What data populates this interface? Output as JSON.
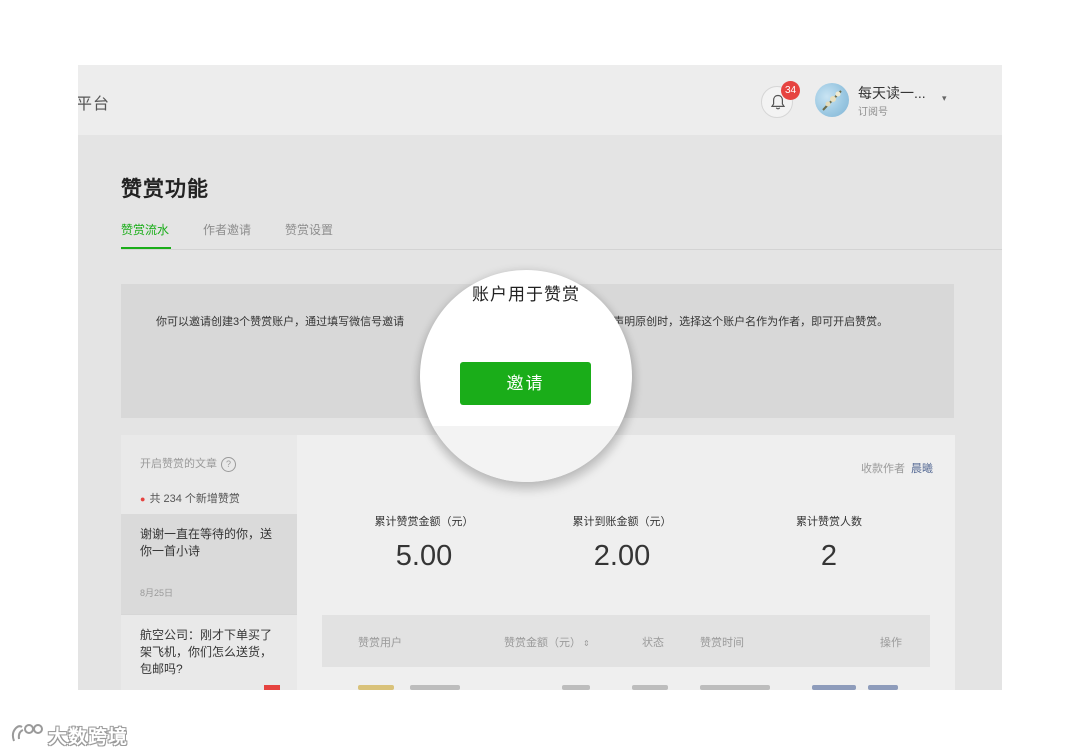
{
  "topbar": {
    "brand": "平台",
    "notification_count": "34",
    "account_name": "每天读一...",
    "account_type": "订阅号",
    "caret": "▾"
  },
  "page": {
    "title": "赞赏功能",
    "tabs": [
      {
        "label": "赞赏流水",
        "active": true
      },
      {
        "label": "作者邀请",
        "active": false
      },
      {
        "label": "赞赏设置",
        "active": false
      }
    ]
  },
  "notice": {
    "text": "你可以邀请创建3个赞赏账户，通过填写微信号邀请　　　　　　　　　　　　　　　你在文章声明原创时，选择这个账户名作为作者，即可开启赞赏。"
  },
  "magnifier": {
    "heading": "账户用于赞赏",
    "button_label": "邀请"
  },
  "sidebar": {
    "heading": "开启赞赏的文章",
    "help": "?",
    "new_count": "共 234 个新增赞赏",
    "articles": [
      {
        "title": "谢谢一直在等待的你，送你一首小诗",
        "date": "8月25日"
      },
      {
        "title": "航空公司：刚才下单买了架飞机，你们怎么送货，包邮吗?",
        "date": ""
      }
    ]
  },
  "stats": {
    "collector_label": "收款作者",
    "collector_name": "晨曦",
    "items": [
      {
        "label": "累计赞赏金额（元）",
        "value": "5.00"
      },
      {
        "label": "累计到账金额（元）",
        "value": "2.00"
      },
      {
        "label": "累计赞赏人数",
        "value": "2"
      }
    ],
    "table_headers": {
      "user": "赞赏用户",
      "amount": "赞赏金额（元）",
      "sort": "⇕",
      "status": "状态",
      "time": "赞赏时间",
      "action": "操作"
    }
  },
  "watermark": {
    "text": "大数跨境"
  },
  "colors": {
    "accent_green": "#1aad19",
    "badge_red": "#e64340",
    "link_blue": "#576b95"
  }
}
